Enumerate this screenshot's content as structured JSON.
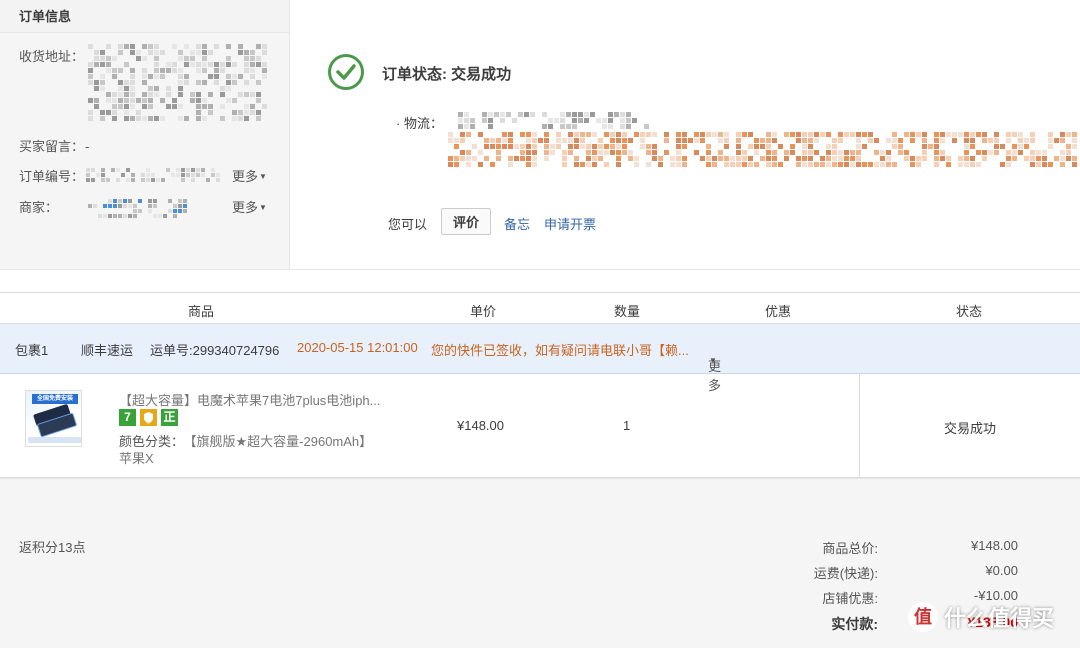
{
  "order_info": {
    "header": "订单信息",
    "address_label": "收货地址：",
    "message_label": "买家留言：",
    "message_value": "-",
    "order_no_label": "订单编号：",
    "merchant_label": "商家：",
    "more_label": "更多"
  },
  "status": {
    "title": "订单状态: 交易成功",
    "logistics_label": "· 物流：",
    "you_can": "您可以",
    "rate_button": "评价",
    "memo_link": "备忘",
    "invoice_link": "申请开票"
  },
  "table": {
    "headers": [
      "商品",
      "单价",
      "数量",
      "优惠",
      "状态"
    ]
  },
  "package": {
    "label": "包裹1",
    "carrier": "顺丰速运",
    "tracking": "运单号:299340724796",
    "time": "2020-05-15 12:01:00",
    "message": "您的快件已签收，如有疑问请电联小哥【赖...",
    "more": "更多"
  },
  "item": {
    "title": "【超大容量】电魔术苹果7电池7plus电池iph...",
    "badges": [
      "7",
      "",
      "正"
    ],
    "variant_label": "颜色分类：",
    "variant_value": "【旗舰版★超大容量-2960mAh】",
    "variant_value2": "苹果X",
    "thumb_text": "全国免费安装",
    "price": "¥148.00",
    "quantity": "1",
    "status": "交易成功"
  },
  "summary": {
    "points": "返积分13点",
    "rows": [
      {
        "label": "商品总价:",
        "value": "¥148.00"
      },
      {
        "label": "运费(快递):",
        "value": "¥0.00"
      },
      {
        "label": "店铺优惠:",
        "value": "-¥10.00"
      }
    ],
    "total_label": "实付款:",
    "total_value": "¥138.00"
  },
  "watermark": {
    "symbol": "值",
    "text": "什么值得买"
  },
  "colors": {
    "accent_link": "#3366aa",
    "package_text": "#c8641e",
    "total_red": "#d40000",
    "success_green": "#4a9a4a",
    "badge_green": "#3aa23a",
    "badge_yellow": "#e6a817"
  }
}
